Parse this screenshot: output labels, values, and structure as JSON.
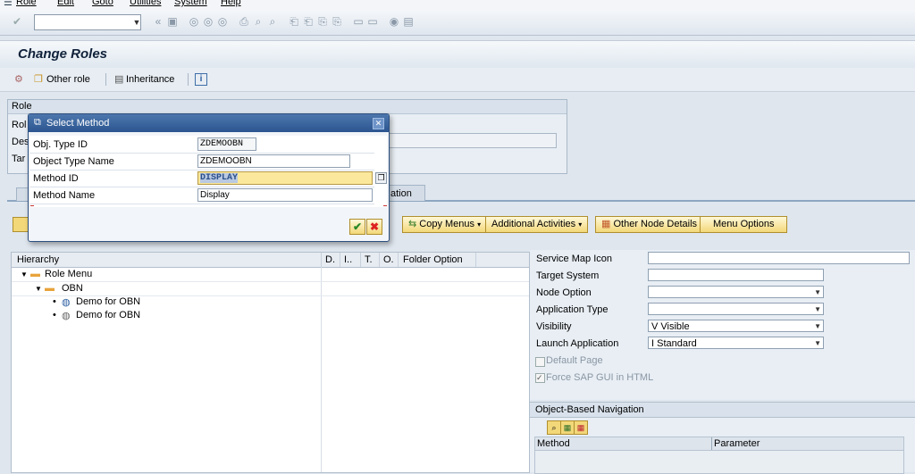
{
  "menubar": {
    "items": [
      "Role",
      "Edit",
      "Goto",
      "Utilities",
      "System",
      "Help"
    ]
  },
  "page": {
    "title": "Change Roles"
  },
  "apptoolbar": {
    "other_role": "Other role",
    "inheritance": "Inheritance"
  },
  "role_group": {
    "header": "Role",
    "label_role": "Rol",
    "label_desc": "Des",
    "label_target": "Tar"
  },
  "tabs": {
    "partial_tab": "ation"
  },
  "buttons": {
    "copy_menus": "Copy Menus",
    "additional_activities": "Additional Activities",
    "other_node_details": "Other Node Details",
    "menu_options": "Menu Options"
  },
  "hierarchy": {
    "columns": [
      "Hierarchy",
      "D.",
      "I..",
      "T.",
      "O.",
      "Folder Option"
    ],
    "rows": [
      {
        "label": "Role Menu"
      },
      {
        "label": "OBN"
      },
      {
        "label": "Demo for OBN"
      },
      {
        "label": "Demo for OBN"
      }
    ]
  },
  "details": {
    "service_map_icon": "Service Map Icon",
    "target_system": "Target System",
    "node_option": "Node Option",
    "application_type": "Application Type",
    "visibility_label": "Visibility",
    "visibility_value": "V Visible",
    "launch_label": "Launch Application",
    "launch_value": "I Standard",
    "default_page": "Default Page",
    "force_sap_gui": "Force SAP GUI in HTML"
  },
  "obn": {
    "header": "Object-Based Navigation",
    "col_method": "Method",
    "col_parameter": "Parameter"
  },
  "dialog": {
    "title": "Select Method",
    "obj_type_id_label": "Obj. Type ID",
    "obj_type_id_value": "ZDEMOOBN",
    "obj_type_name_label": "Object Type Name",
    "obj_type_name_value": "ZDEMOOBN",
    "method_id_label": "Method ID",
    "method_id_value": "DISPLAY",
    "method_name_label": "Method Name",
    "method_name_value": "Display"
  },
  "colors": {
    "accent": "#2c5590",
    "button_yellow": "#f3d879",
    "folder": "#e8a33b"
  }
}
